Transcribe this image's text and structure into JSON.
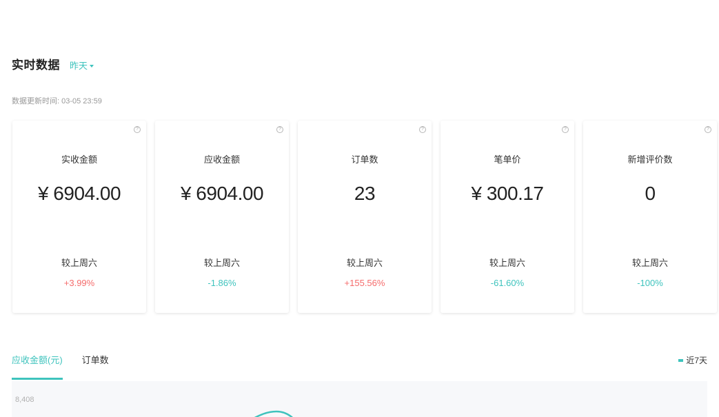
{
  "header": {
    "title": "实时数据",
    "range_label": "昨天",
    "update_time": "数据更新时间: 03-05 23:59"
  },
  "cards": [
    {
      "label": "实收金额",
      "value": "¥ 6904.00",
      "compare_label": "较上周六",
      "change": "+3.99%",
      "trend": "up"
    },
    {
      "label": "应收金额",
      "value": "¥ 6904.00",
      "compare_label": "较上周六",
      "change": "-1.86%",
      "trend": "down"
    },
    {
      "label": "订单数",
      "value": "23",
      "compare_label": "较上周六",
      "change": "+155.56%",
      "trend": "up"
    },
    {
      "label": "笔单价",
      "value": "¥ 300.17",
      "compare_label": "较上周六",
      "change": "-61.60%",
      "trend": "down"
    },
    {
      "label": "新增评价数",
      "value": "0",
      "compare_label": "较上周六",
      "change": "-100%",
      "trend": "down"
    }
  ],
  "tabs": [
    {
      "label": "应收金额(元)",
      "active": true
    },
    {
      "label": "订单数",
      "active": false
    }
  ],
  "legend": {
    "label": "近7天",
    "color": "#3ec3bd"
  },
  "chart": {
    "y_max_label": "8,408"
  },
  "colors": {
    "accent": "#3ec3bd",
    "up": "#f56c6c",
    "down": "#3ec3bd"
  },
  "icons": {
    "help": "help-circle-icon",
    "dropdown": "caret-down-icon"
  }
}
